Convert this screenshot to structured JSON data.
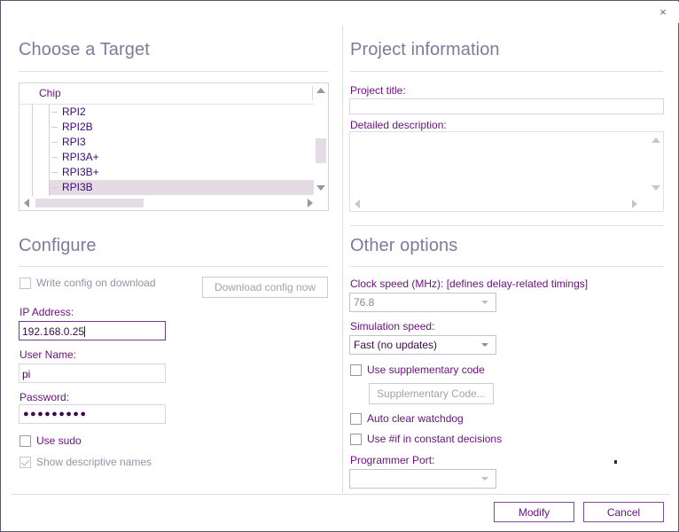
{
  "window": {
    "close_label": "×"
  },
  "left": {
    "target_section": {
      "title": "Choose a Target",
      "tree": {
        "column_header": "Chip",
        "items": [
          {
            "label": "RPI2",
            "selected": false
          },
          {
            "label": "RPI2B",
            "selected": false
          },
          {
            "label": "RPI3",
            "selected": false
          },
          {
            "label": "RPI3A+",
            "selected": false
          },
          {
            "label": "RPI3B+",
            "selected": false
          },
          {
            "label": "RPI3B",
            "selected": true
          }
        ]
      }
    },
    "configure_section": {
      "title": "Configure",
      "write_config_checkbox": {
        "label": "Write config on download",
        "checked": false,
        "enabled": false
      },
      "download_button": {
        "label": "Download config now",
        "enabled": false
      },
      "ip_address": {
        "label": "IP Address:",
        "value": "192.168.0.25",
        "placeholder": ""
      },
      "user_name": {
        "label": "User Name:",
        "value": "pi",
        "placeholder": ""
      },
      "password": {
        "label": "Password:",
        "value": "●●●●●●●●●",
        "placeholder": ""
      },
      "use_sudo_checkbox": {
        "label": "Use sudo",
        "checked": false,
        "enabled": true
      },
      "show_names_checkbox": {
        "label": "Show descriptive names",
        "checked": true,
        "enabled": false
      }
    }
  },
  "right": {
    "project_section": {
      "title": "Project information",
      "project_title": {
        "label": "Project title:",
        "value": "",
        "placeholder": ""
      },
      "detailed_description": {
        "label": "Detailed description:",
        "value": "",
        "placeholder": ""
      }
    },
    "other_section": {
      "title": "Other options",
      "clock_speed": {
        "label": "Clock speed (MHz): [defines delay-related timings]",
        "value": "76.8",
        "enabled": false
      },
      "simulation_speed": {
        "label": "Simulation speed:",
        "value": "Fast (no updates)",
        "enabled": true
      },
      "use_supplementary_checkbox": {
        "label": "Use supplementary code",
        "checked": false,
        "enabled": true
      },
      "supplementary_button": {
        "label": "Supplementary Code...",
        "enabled": false
      },
      "auto_clear_watchdog_checkbox": {
        "label": "Auto clear watchdog",
        "checked": false,
        "enabled": true
      },
      "use_if_checkbox": {
        "label": "Use #if in constant decisions",
        "checked": false,
        "enabled": true
      },
      "programmer_port": {
        "label": "Programmer Port:",
        "value": "",
        "enabled": true
      }
    }
  },
  "footer": {
    "modify_label": "Modify",
    "cancel_label": "Cancel"
  },
  "colors": {
    "accent": "#6a107e",
    "heading": "#7e7a9b",
    "selection": "#e5dbe5",
    "border": "#5e5572",
    "scrollbar_thumb": "#e5dde6"
  }
}
